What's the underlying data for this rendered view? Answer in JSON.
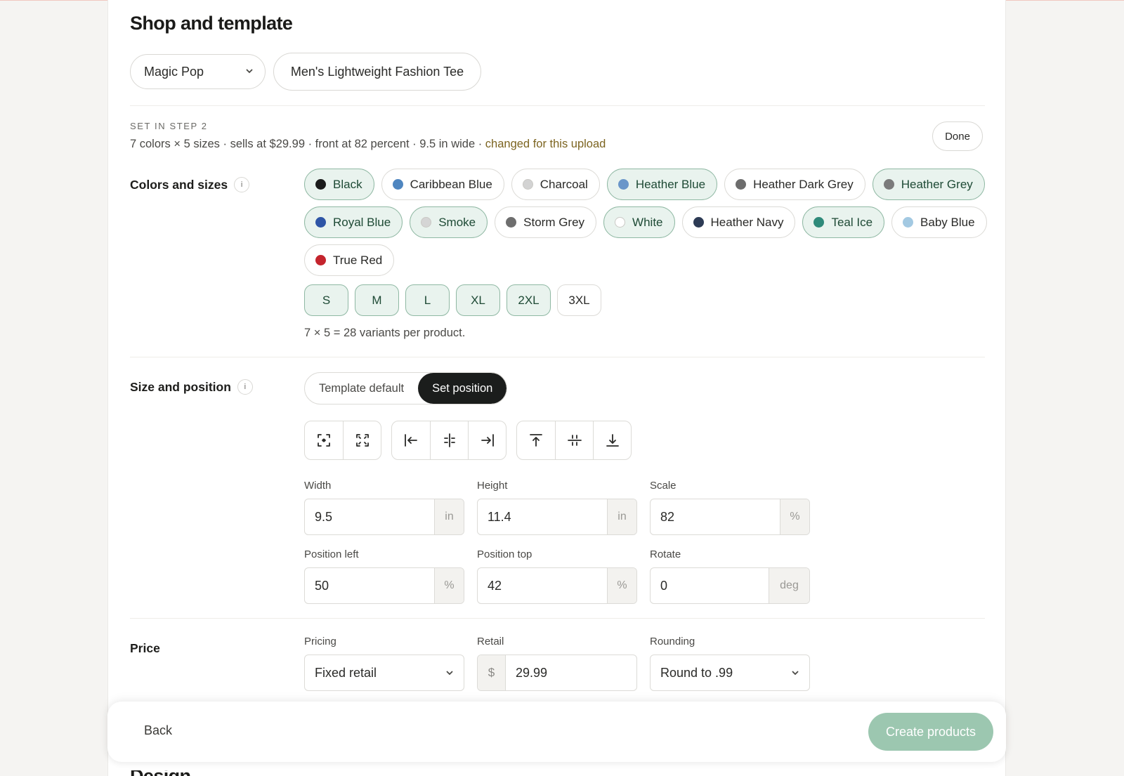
{
  "section": {
    "title": "Shop and template"
  },
  "shop": {
    "value": "Magic Pop"
  },
  "template": {
    "value": "Men's Lightweight Fashion Tee"
  },
  "step": {
    "label": "SET IN STEP 2",
    "summary": "7 colors × 5 sizes · sells at $29.99 · front at 82 percent · 9.5 in wide · ",
    "changed": "changed for this upload",
    "done_label": "Done"
  },
  "colors": {
    "label": "Colors and sizes",
    "info": "i",
    "rows": [
      [
        {
          "name": "Black",
          "hex": "#1b1b1b",
          "selected": true
        },
        {
          "name": "Caribbean Blue",
          "hex": "#4f86c0",
          "selected": false
        },
        {
          "name": "Charcoal",
          "hex": "#d3d3d3",
          "selected": false
        },
        {
          "name": "Heather Blue",
          "hex": "#6a96c9",
          "selected": true
        },
        {
          "name": "Heather Dark Grey",
          "hex": "#6d6d6d",
          "selected": false
        },
        {
          "name": "Heather Grey",
          "hex": "#7b7b7b",
          "selected": true
        }
      ],
      [
        {
          "name": "Royal Blue",
          "hex": "#2e55a6",
          "selected": true
        },
        {
          "name": "Smoke",
          "hex": "#d5d5d5",
          "selected": true
        },
        {
          "name": "Storm Grey",
          "hex": "#6e6e6e",
          "selected": false
        },
        {
          "name": "White",
          "hex": "#ffffff",
          "selected": true
        },
        {
          "name": "Heather Navy",
          "hex": "#2d3b55",
          "selected": false
        },
        {
          "name": "Teal Ice",
          "hex": "#2f8a7a",
          "selected": true
        },
        {
          "name": "Baby Blue",
          "hex": "#a3c9e2",
          "selected": false
        }
      ],
      [
        {
          "name": "True Red",
          "hex": "#c4242d",
          "selected": false
        }
      ]
    ],
    "sizes": [
      {
        "name": "S",
        "selected": true
      },
      {
        "name": "M",
        "selected": true
      },
      {
        "name": "L",
        "selected": true
      },
      {
        "name": "XL",
        "selected": true
      },
      {
        "name": "2XL",
        "selected": true
      },
      {
        "name": "3XL",
        "selected": false
      }
    ],
    "variant_note": "7 × 5 = 28 variants per product."
  },
  "position": {
    "label": "Size and position",
    "info": "i",
    "modes": [
      "Template default",
      "Set position"
    ],
    "active_mode": "Set position",
    "tools": {
      "fit": [
        "fit-icon",
        "fill-icon"
      ],
      "horizontal": [
        "align-left-icon",
        "align-center-horizontal-icon",
        "align-right-icon"
      ],
      "vertical": [
        "align-top-icon",
        "align-middle-vertical-icon",
        "align-bottom-icon"
      ]
    },
    "width": {
      "label": "Width",
      "value": "9.5",
      "unit": "in"
    },
    "height": {
      "label": "Height",
      "value": "11.4",
      "unit": "in"
    },
    "scale": {
      "label": "Scale",
      "value": "82",
      "unit": "%"
    },
    "left": {
      "label": "Position left",
      "value": "50",
      "unit": "%"
    },
    "top": {
      "label": "Position top",
      "value": "42",
      "unit": "%"
    },
    "rotate": {
      "label": "Rotate",
      "value": "0",
      "unit": "deg"
    }
  },
  "price": {
    "label": "Price",
    "pricing": {
      "label": "Pricing",
      "value": "Fixed retail"
    },
    "retail": {
      "label": "Retail",
      "prefix": "$",
      "value": "29.99"
    },
    "rounding": {
      "label": "Rounding",
      "value": "Round to .99"
    }
  },
  "footer": {
    "back_label": "Back",
    "create_label": "Create products"
  },
  "next_section_peek": "Design"
}
